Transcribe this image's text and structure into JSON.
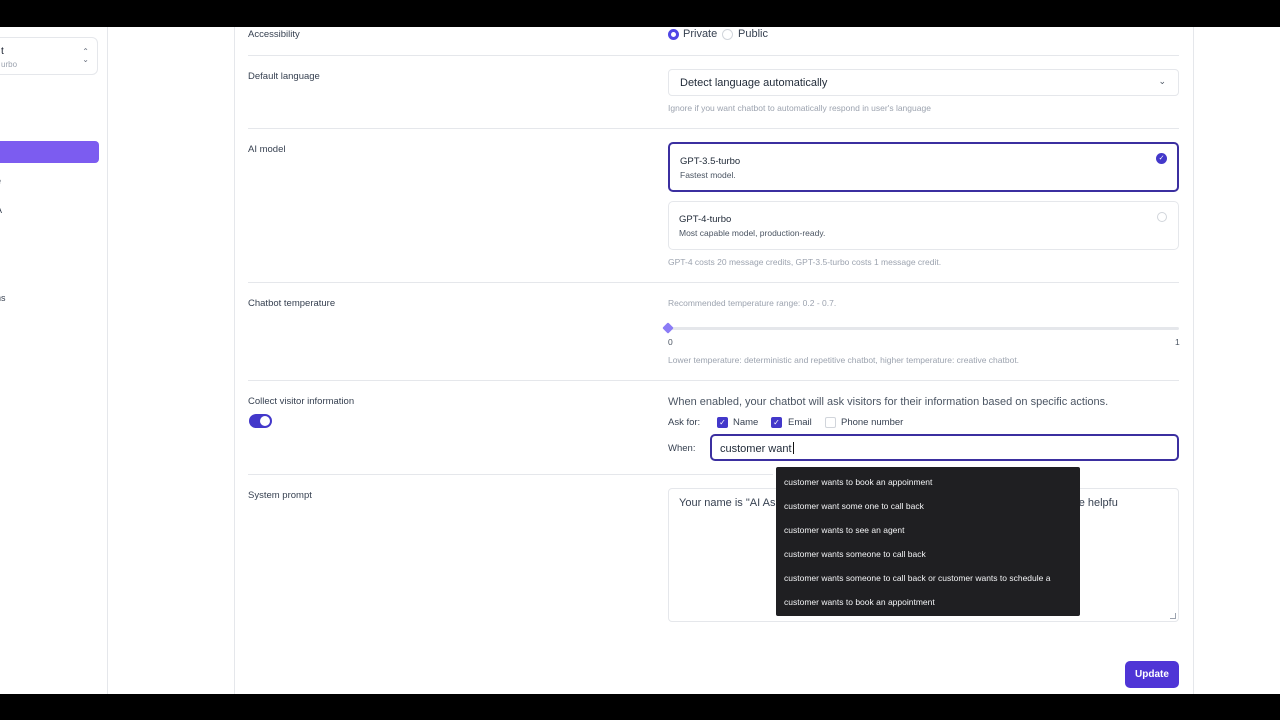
{
  "sidebar": {
    "model_picker": {
      "title": "t",
      "subtitle": "urbo"
    },
    "items": [
      {
        "label": "e"
      },
      {
        "label": "A"
      },
      {
        "label": ""
      },
      {
        "label": "ns"
      }
    ]
  },
  "accessibility": {
    "label": "Accessibility",
    "options": [
      "Private",
      "Public"
    ],
    "selected": "Private"
  },
  "language": {
    "label": "Default language",
    "value": "Detect language automatically",
    "help": "Ignore if you want chatbot to automatically respond in user's language"
  },
  "ai_model": {
    "label": "AI model",
    "options": [
      {
        "name": "GPT-3.5-turbo",
        "desc": "Fastest model.",
        "selected": true
      },
      {
        "name": "GPT-4-turbo",
        "desc": "Most capable model, production-ready.",
        "selected": false
      }
    ],
    "help": "GPT-4 costs 20 message credits, GPT-3.5-turbo costs 1 message credit."
  },
  "temperature": {
    "label": "Chatbot temperature",
    "recommended": "Recommended temperature range: 0.2 - 0.7.",
    "min_label": "0",
    "max_label": "1",
    "value": 0,
    "help": "Lower temperature: deterministic and repetitive chatbot, higher temperature: creative chatbot."
  },
  "visitor_info": {
    "label": "Collect visitor information",
    "enabled": true,
    "description": "When enabled, your chatbot will ask visitors for their information based on specific actions.",
    "ask_for_label": "Ask for:",
    "fields": [
      {
        "label": "Name",
        "checked": true
      },
      {
        "label": "Email",
        "checked": true
      },
      {
        "label": "Phone number",
        "checked": false
      }
    ],
    "when_label": "When:",
    "when_value": "customer want",
    "suggestions": [
      "customer wants to book an appoinment",
      "customer want some one to call back",
      "customer wants to see an agent",
      "customer wants someone to call back",
      "customer wants someone to call back or customer wants to schedule a",
      "customer wants to book an appointment"
    ]
  },
  "system_prompt": {
    "label": "System prompt",
    "text": "Your name is \"AI Ass                                                                      ng to an user. Refer to customer as                                                                      nd concise responses. Be helpfu"
  },
  "actions": {
    "update_label": "Update"
  },
  "colors": {
    "accent": "#4f35d6",
    "sidebar_active": "#7c5cf0",
    "dropdown_bg": "#1f1f22"
  }
}
